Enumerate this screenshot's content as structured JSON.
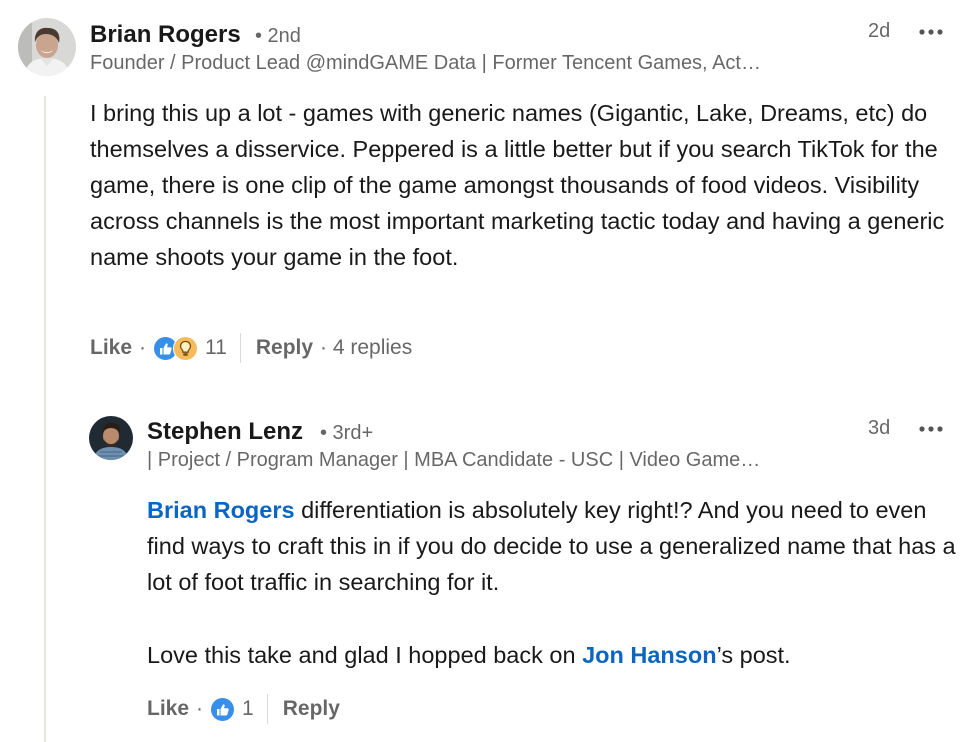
{
  "comment": {
    "author": "Brian Rogers",
    "degree": "• 2nd",
    "headline": "Founder / Product Lead @mindGAME Data | Former Tencent Games, Act…",
    "time": "2d",
    "text": "I bring this up a lot - games with generic names (Gigantic, Lake, Dreams, etc) do themselves a disservice. Peppered is a little better but if you search TikTok for the game, there is one clip of the game amongst thousands of food videos. Visibility across channels is the most important marketing tactic today and having a generic name shoots your game in the foot.",
    "like_label": "Like",
    "dot": "·",
    "reaction_count": "11",
    "reaction_icons": [
      "like-icon",
      "insightful-icon"
    ],
    "reply_label": "Reply",
    "replies_text": "· 4 replies"
  },
  "reply": {
    "author": "Stephen Lenz",
    "degree": "• 3rd+",
    "headline": "| Project / Program Manager | MBA Candidate - USC | Video Game…",
    "time": "3d",
    "mention1": "Brian Rogers",
    "text1": " differentiation is absolutely key right!? And you need to even find ways to craft this in if you do decide to use a generalized name that has a lot of foot traffic in searching for it.",
    "text2_before": "Love this take and glad I hopped back on ",
    "mention2": "Jon Hanson",
    "text2_after": "’s post.",
    "like_label": "Like",
    "dot": "·",
    "reaction_count": "1",
    "reaction_icons": [
      "like-icon"
    ],
    "reply_label": "Reply"
  },
  "colors": {
    "link": "#0a66c2",
    "like_blue": "#378fe9",
    "insightful_yellow": "#f5bb5c",
    "thread_line": "#e8e6e2"
  }
}
